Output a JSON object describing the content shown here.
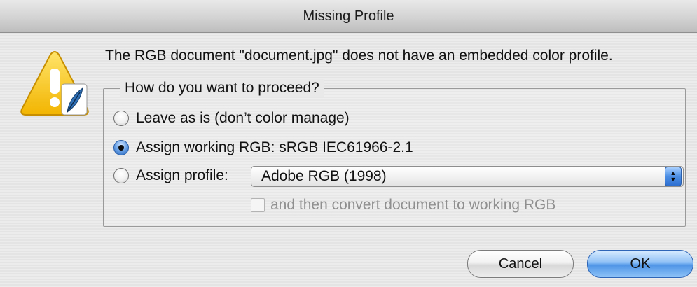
{
  "window": {
    "title": "Missing Profile"
  },
  "dialog": {
    "message": "The RGB document \"document.jpg\" does not have an embedded color profile.",
    "group_title": "How do you want to proceed?",
    "options": [
      {
        "label": "Leave as is (don’t color manage)",
        "checked": false
      },
      {
        "label": "Assign working RGB:  sRGB IEC61966-2.1",
        "checked": true
      },
      {
        "label": "Assign profile:",
        "checked": false
      }
    ],
    "profile_select": {
      "value": "Adobe RGB (1998)"
    },
    "convert_checkbox": {
      "label": "and then convert document to working RGB",
      "checked": false,
      "enabled": false
    }
  },
  "buttons": {
    "cancel_label": "Cancel",
    "ok_label": "OK"
  },
  "icons": {
    "alert": "warning-triangle-icon",
    "app_badge": "feather-icon",
    "select_arrows": "updown-arrows-icon"
  },
  "colors": {
    "accent": "#4b8ee4",
    "warning": "#f7c21a"
  }
}
